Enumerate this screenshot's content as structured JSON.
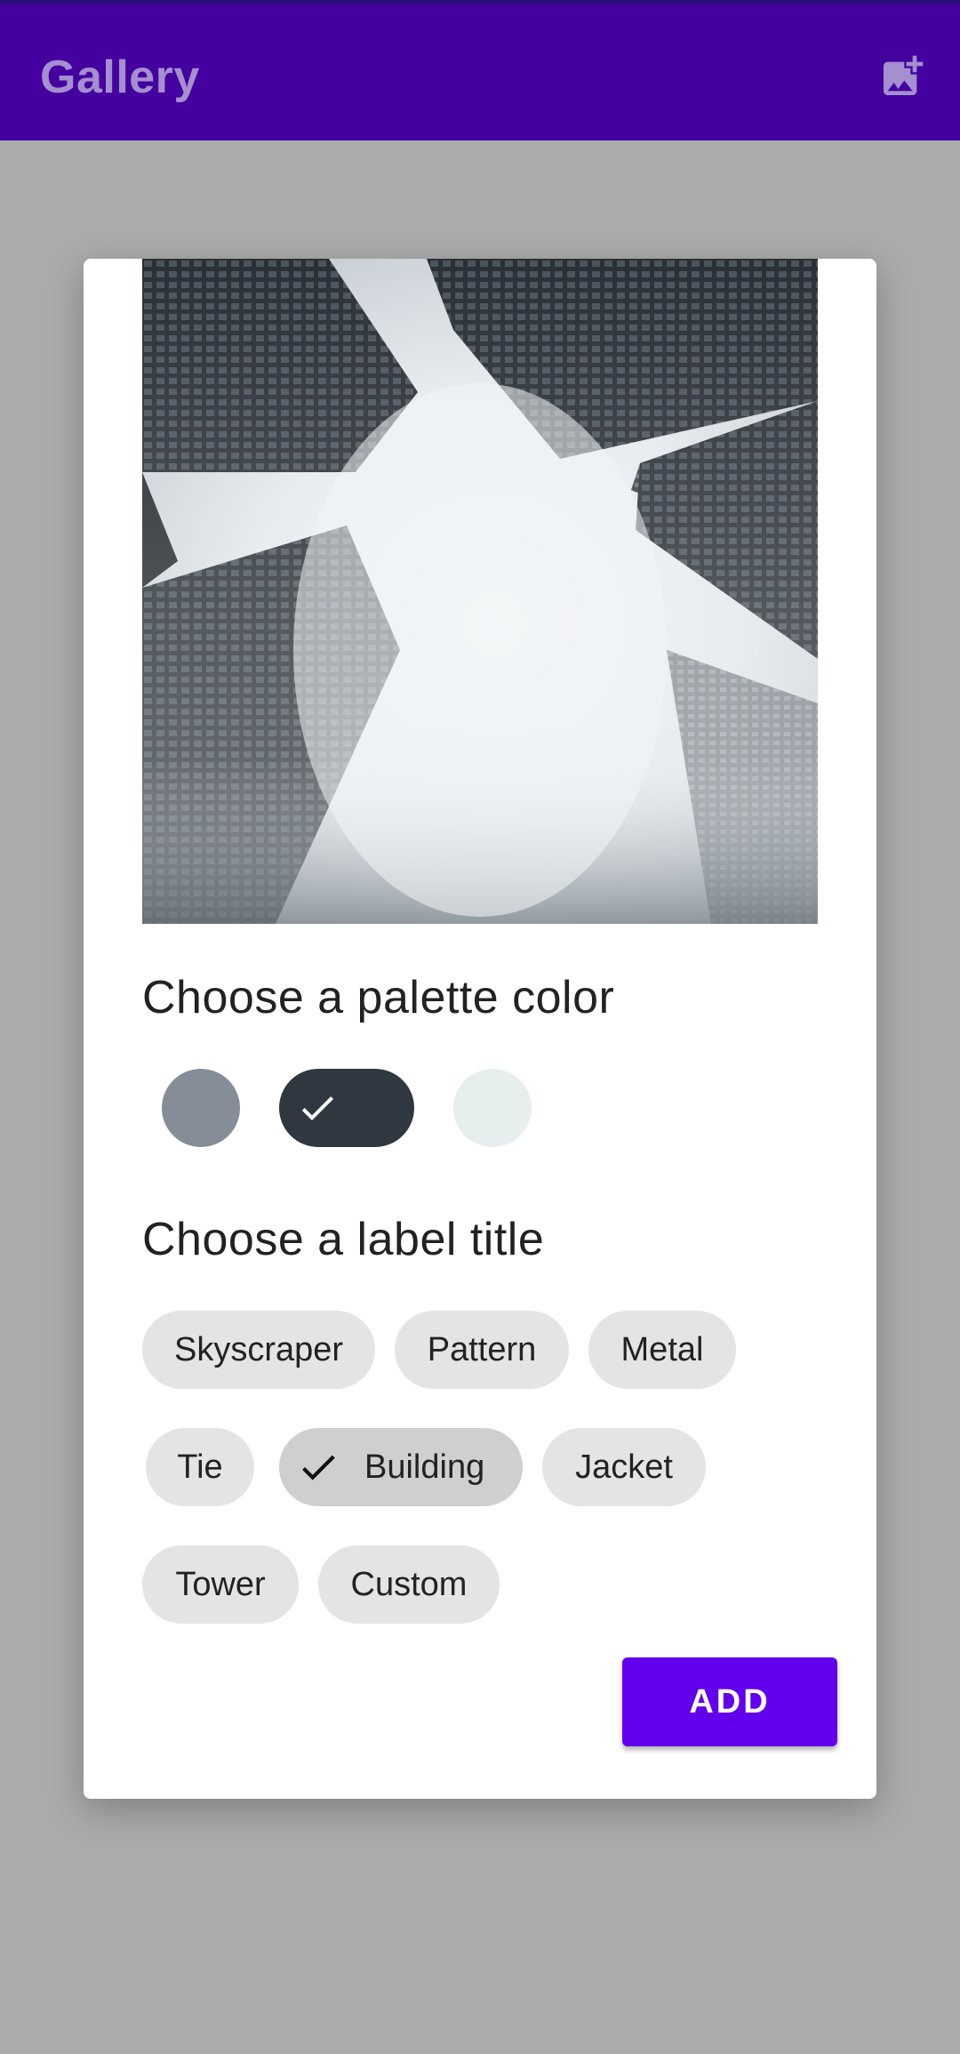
{
  "app_bar": {
    "title": "Gallery",
    "action_icon": "add-photo-icon",
    "background": "#4500a0",
    "title_color": "#a48fcf"
  },
  "dialog": {
    "image_alt": "Skyscrapers viewed from below into fog",
    "palette_title": "Choose a palette color",
    "palette": [
      {
        "color": "#858e98",
        "selected": false
      },
      {
        "color": "#2f3740",
        "selected": true
      },
      {
        "color": "#e7eeee",
        "selected": false
      }
    ],
    "label_title": "Choose a label title",
    "labels": [
      {
        "text": "Skyscraper",
        "selected": false
      },
      {
        "text": "Pattern",
        "selected": false
      },
      {
        "text": "Metal",
        "selected": false
      },
      {
        "text": "Tie",
        "selected": false
      },
      {
        "text": "Building",
        "selected": true
      },
      {
        "text": "Jacket",
        "selected": false
      },
      {
        "text": "Tower",
        "selected": false
      },
      {
        "text": "Custom",
        "selected": false
      }
    ],
    "add_button": "ADD",
    "accent": "#6200ee"
  }
}
